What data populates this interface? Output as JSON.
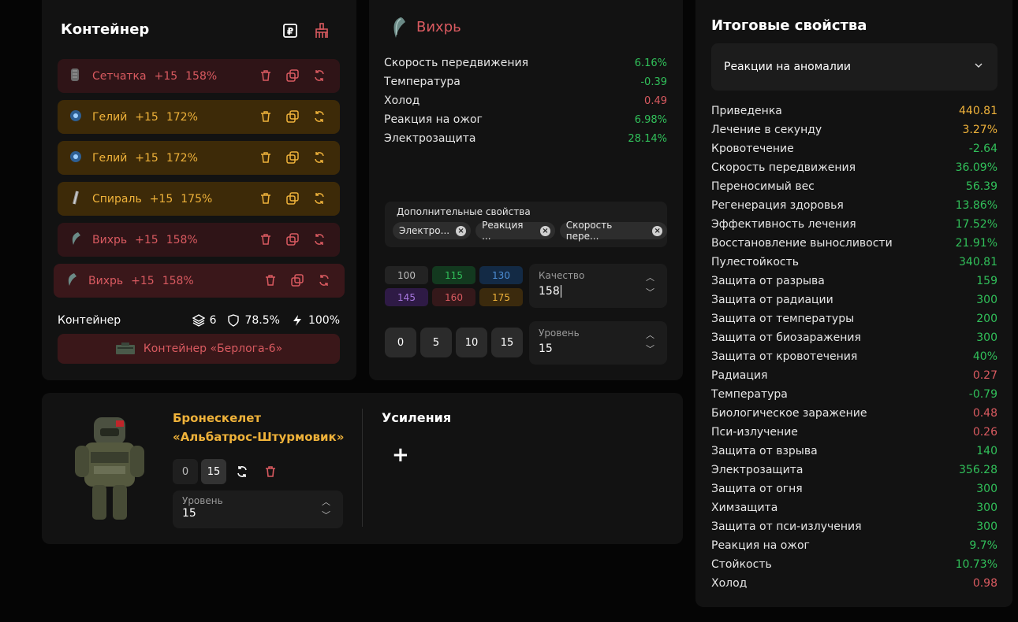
{
  "container": {
    "title": "Контейнер",
    "items": [
      {
        "name": "Сетчатка",
        "ench": "+15",
        "pct": "158%",
        "tone": "red",
        "icon": "retina-artifact-icon"
      },
      {
        "name": "Гелий",
        "ench": "+15",
        "pct": "172%",
        "tone": "gold",
        "icon": "helium-artifact-icon"
      },
      {
        "name": "Гелий",
        "ench": "+15",
        "pct": "172%",
        "tone": "gold",
        "icon": "helium-artifact-icon"
      },
      {
        "name": "Спираль",
        "ench": "+15",
        "pct": "175%",
        "tone": "gold",
        "icon": "spiral-artifact-icon"
      },
      {
        "name": "Вихрь",
        "ench": "+15",
        "pct": "158%",
        "tone": "red",
        "icon": "vortex-artifact-icon"
      },
      {
        "name": "Вихрь",
        "ench": "+15",
        "pct": "158%",
        "tone": "red-sel",
        "icon": "vortex-artifact-icon"
      }
    ],
    "footer_label": "Контейнер",
    "slots": "6",
    "protection": "78.5%",
    "efficiency": "100%",
    "select_button": "Контейнер «Берлога-6»"
  },
  "artifact": {
    "title": "Вихрь",
    "props": [
      {
        "label": "Скорость передвижения",
        "value": "6.16%",
        "tone": "green"
      },
      {
        "label": "Температура",
        "value": "-0.39",
        "tone": "green"
      },
      {
        "label": "Холод",
        "value": "0.49",
        "tone": "red"
      },
      {
        "label": "Реакция на ожог",
        "value": "6.98%",
        "tone": "green"
      },
      {
        "label": "Электрозащита",
        "value": "28.14%",
        "tone": "green"
      }
    ],
    "additional_label": "Дополнительные свойства",
    "chips": [
      "Электро...",
      "Реакция ...",
      "Скорость пере..."
    ],
    "quality_presets": [
      "100",
      "115",
      "130",
      "145",
      "160",
      "175"
    ],
    "quality_label": "Качество",
    "quality_value": "158",
    "level_presets": [
      "0",
      "5",
      "10",
      "15"
    ],
    "level_label": "Уровень",
    "level_value": "15"
  },
  "exo": {
    "name_line1": "Бронескелет",
    "name_line2": "«Альбатрос-Штурмовик»",
    "level_btn_0": "0",
    "level_btn_15": "15",
    "level_label": "Уровень",
    "level_value": "15",
    "boosts_title": "Усиления",
    "add_symbol": "+"
  },
  "summary": {
    "title": "Итоговые свойства",
    "select": "Реакции на аномалии",
    "props": [
      {
        "label": "Приведенка",
        "value": "440.81",
        "tone": "gold"
      },
      {
        "label": "Лечение в секунду",
        "value": "3.27%",
        "tone": "gold"
      },
      {
        "label": "Кровотечение",
        "value": "-2.64",
        "tone": "green"
      },
      {
        "label": "Скорость передвижения",
        "value": "36.09%",
        "tone": "green"
      },
      {
        "label": "Переносимый вес",
        "value": "56.39",
        "tone": "green"
      },
      {
        "label": "Регенерация здоровья",
        "value": "13.86%",
        "tone": "green"
      },
      {
        "label": "Эффективность лечения",
        "value": "17.52%",
        "tone": "green"
      },
      {
        "label": "Восстановление выносливости",
        "value": "21.91%",
        "tone": "green"
      },
      {
        "label": "Пулестойкость",
        "value": "340.81",
        "tone": "green"
      },
      {
        "label": "Защита от разрыва",
        "value": "159",
        "tone": "green"
      },
      {
        "label": "Защита от радиации",
        "value": "300",
        "tone": "green"
      },
      {
        "label": "Защита от температуры",
        "value": "200",
        "tone": "green"
      },
      {
        "label": "Защита от биозаражения",
        "value": "300",
        "tone": "green"
      },
      {
        "label": "Защита от кровотечения",
        "value": "40%",
        "tone": "green"
      },
      {
        "label": "Радиация",
        "value": "0.27",
        "tone": "red"
      },
      {
        "label": "Температура",
        "value": "-0.79",
        "tone": "green"
      },
      {
        "label": "Биологическое заражение",
        "value": "0.48",
        "tone": "red"
      },
      {
        "label": "Пси-излучение",
        "value": "0.26",
        "tone": "red"
      },
      {
        "label": "Защита от взрыва",
        "value": "140",
        "tone": "green"
      },
      {
        "label": "Электрозащита",
        "value": "356.28",
        "tone": "green"
      },
      {
        "label": "Защита от огня",
        "value": "300",
        "tone": "green"
      },
      {
        "label": "Химзащита",
        "value": "300",
        "tone": "green"
      },
      {
        "label": "Защита от пси-излучения",
        "value": "300",
        "tone": "green"
      },
      {
        "label": "Реакция на ожог",
        "value": "9.7%",
        "tone": "green"
      },
      {
        "label": "Стойкость",
        "value": "10.73%",
        "tone": "green"
      },
      {
        "label": "Холод",
        "value": "0.98",
        "tone": "red"
      }
    ]
  },
  "colors": {
    "green": "#31c05a",
    "red": "#d95a60",
    "gold": "#efb23a",
    "panel": "#121212",
    "background": "#050505"
  }
}
